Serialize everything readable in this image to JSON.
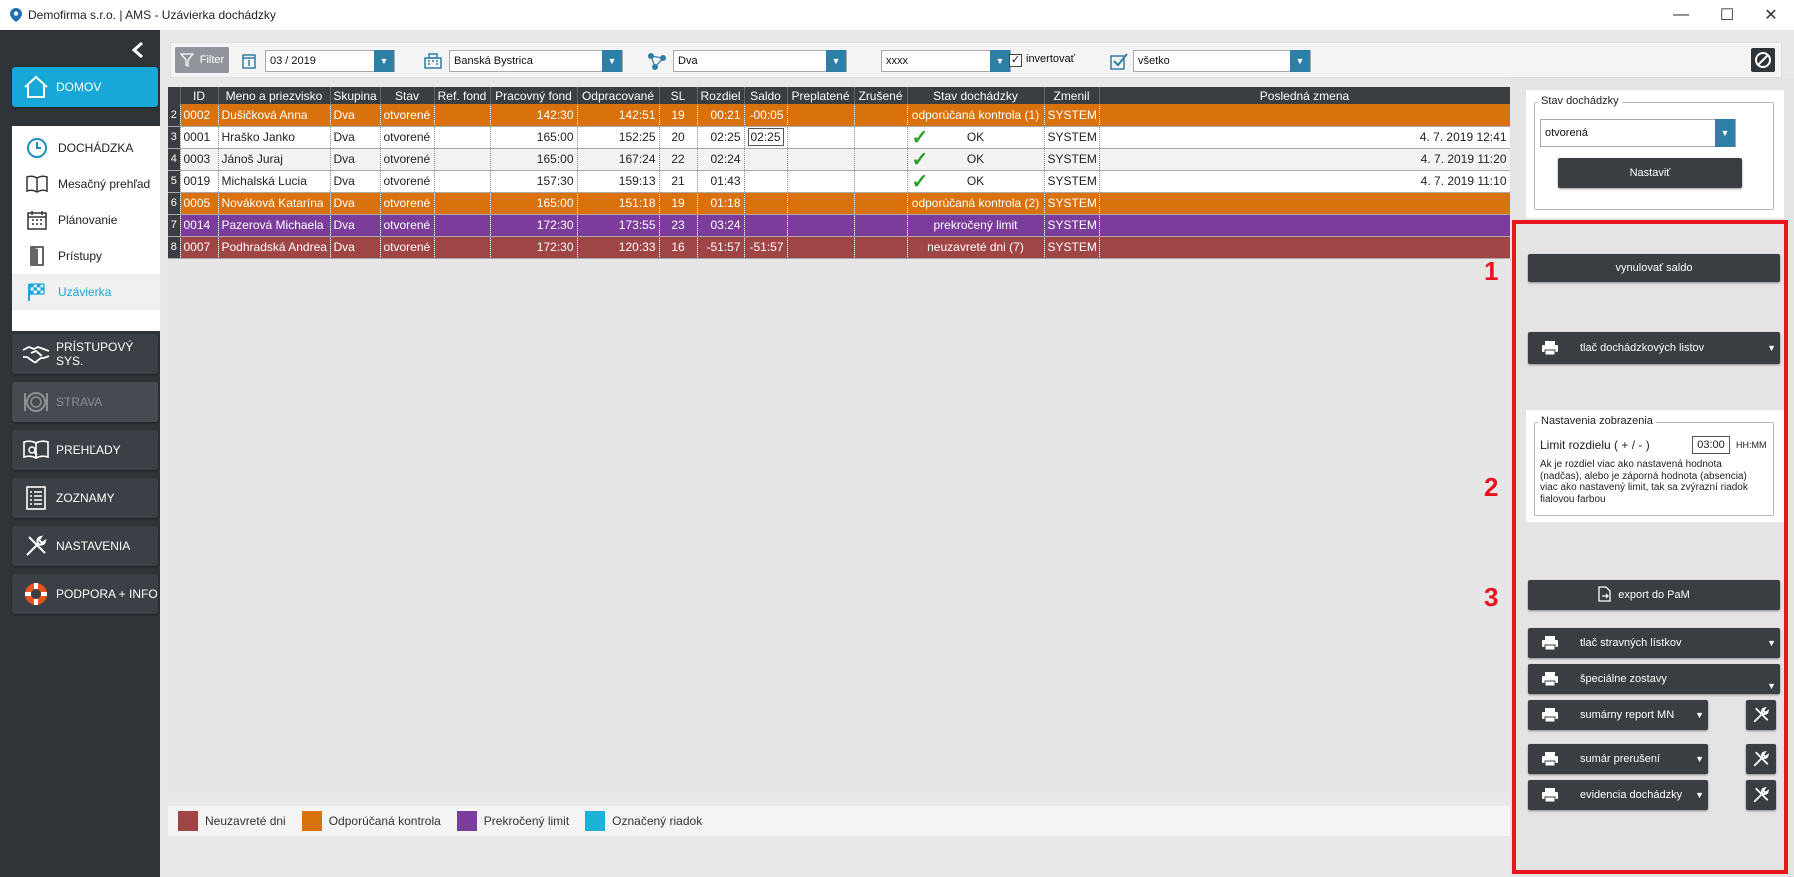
{
  "window": {
    "title": "Demofirma s.r.o. | AMS - Uzávierka dochádzky",
    "minimize": "—",
    "maximize": "☐",
    "close": "✕"
  },
  "sidebar": {
    "home_label": "DOMOV",
    "sub_items": [
      {
        "label": "DOCHÁDZKA",
        "icon": "clock-icon"
      },
      {
        "label": "Mesačný prehľad",
        "icon": "book-icon"
      },
      {
        "label": "Plánovanie",
        "icon": "calendar-icon"
      },
      {
        "label": "Prístupy",
        "icon": "door-icon"
      },
      {
        "label": "Uzávierka",
        "icon": "checkered-flag-icon"
      }
    ],
    "sections": [
      {
        "label": "PRÍSTUPOVÝ SYS.",
        "icon": "handshake-icon",
        "disabled": false
      },
      {
        "label": "STRAVA",
        "icon": "plate-icon",
        "disabled": true
      },
      {
        "label": "PREHĽADY",
        "icon": "book-search-icon",
        "disabled": false
      },
      {
        "label": "ZOZNAMY",
        "icon": "list-icon",
        "disabled": false
      },
      {
        "label": "NASTAVENIA",
        "icon": "tools-icon",
        "disabled": false
      },
      {
        "label": "PODPORA + INFO",
        "icon": "lifebuoy-icon",
        "disabled": false
      }
    ]
  },
  "toolbar": {
    "filter_label": "Filter",
    "period": "03 / 2019",
    "location": "Banská Bystrica",
    "group": "Dva",
    "code": "xxxx",
    "invert_label": "invertovať",
    "invert_checked": true,
    "state": "všetko"
  },
  "table": {
    "columns": [
      "ID",
      "Meno a priezvisko",
      "Skupina",
      "Stav",
      "Ref. fond",
      "Pracovný fond",
      "Odpracované",
      "SL",
      "Rozdiel",
      "Saldo",
      "Preplatené",
      "Zrušené",
      "Stav dochádzky",
      "Zmenil",
      "Posledná zmena"
    ],
    "rows": [
      {
        "n": "2",
        "id": "0002",
        "name": "Dušičková Anna",
        "group": "Dva",
        "state": "otvorené",
        "ref": "",
        "fund": "142:30",
        "worked": "142:51",
        "sl": "19",
        "diff": "00:21",
        "saldo": "-00:05",
        "over": "",
        "cancel": "",
        "status": "odporúčaná kontrola (1)",
        "tick": false,
        "by": "SYSTEM",
        "last": "",
        "style": "orange"
      },
      {
        "n": "3",
        "id": "0001",
        "name": "Hraško Janko",
        "group": "Dva",
        "state": "otvorené",
        "ref": "",
        "fund": "165:00",
        "worked": "152:25",
        "sl": "20",
        "diff": "02:25",
        "saldo": "02:25",
        "over": "",
        "cancel": "",
        "status": "OK",
        "tick": true,
        "by": "SYSTEM",
        "last": "4. 7. 2019 12:41",
        "style": "white"
      },
      {
        "n": "4",
        "id": "0003",
        "name": "Jánoš Juraj",
        "group": "Dva",
        "state": "otvorené",
        "ref": "",
        "fund": "165:00",
        "worked": "167:24",
        "sl": "22",
        "diff": "02:24",
        "saldo": "",
        "over": "",
        "cancel": "",
        "status": "OK",
        "tick": true,
        "by": "SYSTEM",
        "last": "4. 7. 2019 11:20",
        "style": "white2"
      },
      {
        "n": "5",
        "id": "0019",
        "name": "Michalská Lucia",
        "group": "Dva",
        "state": "otvorené",
        "ref": "",
        "fund": "157:30",
        "worked": "159:13",
        "sl": "21",
        "diff": "01:43",
        "saldo": "",
        "over": "",
        "cancel": "",
        "status": "OK",
        "tick": true,
        "by": "SYSTEM",
        "last": "4. 7. 2019 11:10",
        "style": "white"
      },
      {
        "n": "6",
        "id": "0005",
        "name": "Nováková Katarína",
        "group": "Dva",
        "state": "otvorené",
        "ref": "",
        "fund": "165:00",
        "worked": "151:18",
        "sl": "19",
        "diff": "01:18",
        "saldo": "",
        "over": "",
        "cancel": "",
        "status": "odporúčaná kontrola (2)",
        "tick": false,
        "by": "SYSTEM",
        "last": "",
        "style": "orange"
      },
      {
        "n": "7",
        "id": "0014",
        "name": "Pazerová Michaela",
        "group": "Dva",
        "state": "otvorené",
        "ref": "",
        "fund": "172:30",
        "worked": "173:55",
        "sl": "23",
        "diff": "03:24",
        "saldo": "",
        "over": "",
        "cancel": "",
        "status": "prekročený limit",
        "tick": false,
        "by": "SYSTEM",
        "last": "",
        "style": "purple"
      },
      {
        "n": "8",
        "id": "0007",
        "name": "Podhradská Andrea",
        "group": "Dva",
        "state": "otvorené",
        "ref": "",
        "fund": "172:30",
        "worked": "120:33",
        "sl": "16",
        "diff": "-51:57",
        "saldo": "-51:57",
        "over": "",
        "cancel": "",
        "status": "neuzavreté dni (7)",
        "tick": false,
        "by": "SYSTEM",
        "last": "",
        "style": "red"
      }
    ]
  },
  "legend": [
    {
      "label": "Neuzavreté dni",
      "color": "#a04545"
    },
    {
      "label": "Odporúčaná kontrola",
      "color": "#d9720c"
    },
    {
      "label": "Prekročený limit",
      "color": "#7b3c9c"
    },
    {
      "label": "Označený riadok",
      "color": "#1bb3d6"
    }
  ],
  "right_panel": {
    "state_group_label": "Stav dochádzky",
    "state_value": "otvorená",
    "set_button": "Nastaviť",
    "reset_saldo": "vynulovať saldo",
    "print_sheets": "tlač dochádzkových listov",
    "display_group_label": "Nastavenia zobrazenia",
    "limit_label": "Limit rozdielu ( + / - )",
    "limit_value": "03:00",
    "limit_unit": "HH:MM",
    "limit_note": "Ak je rozdiel viac ako nastavená hodnota (nadčas), alebo je záporná hodnota (absencia) viac ako nastavený limit, tak sa zvýrazní riadok fialovou farbou",
    "export_label": "export do PaM",
    "print_meal": "tlač stravných lístkov",
    "special_reports": "špeciálne zostavy",
    "summary_report": "sumárny report MN",
    "interruptions": "sumár prerušení",
    "attendance_record": "evidencia dochádzky",
    "markers": [
      "1",
      "2",
      "3"
    ],
    "accent_red": "#e8141e"
  }
}
